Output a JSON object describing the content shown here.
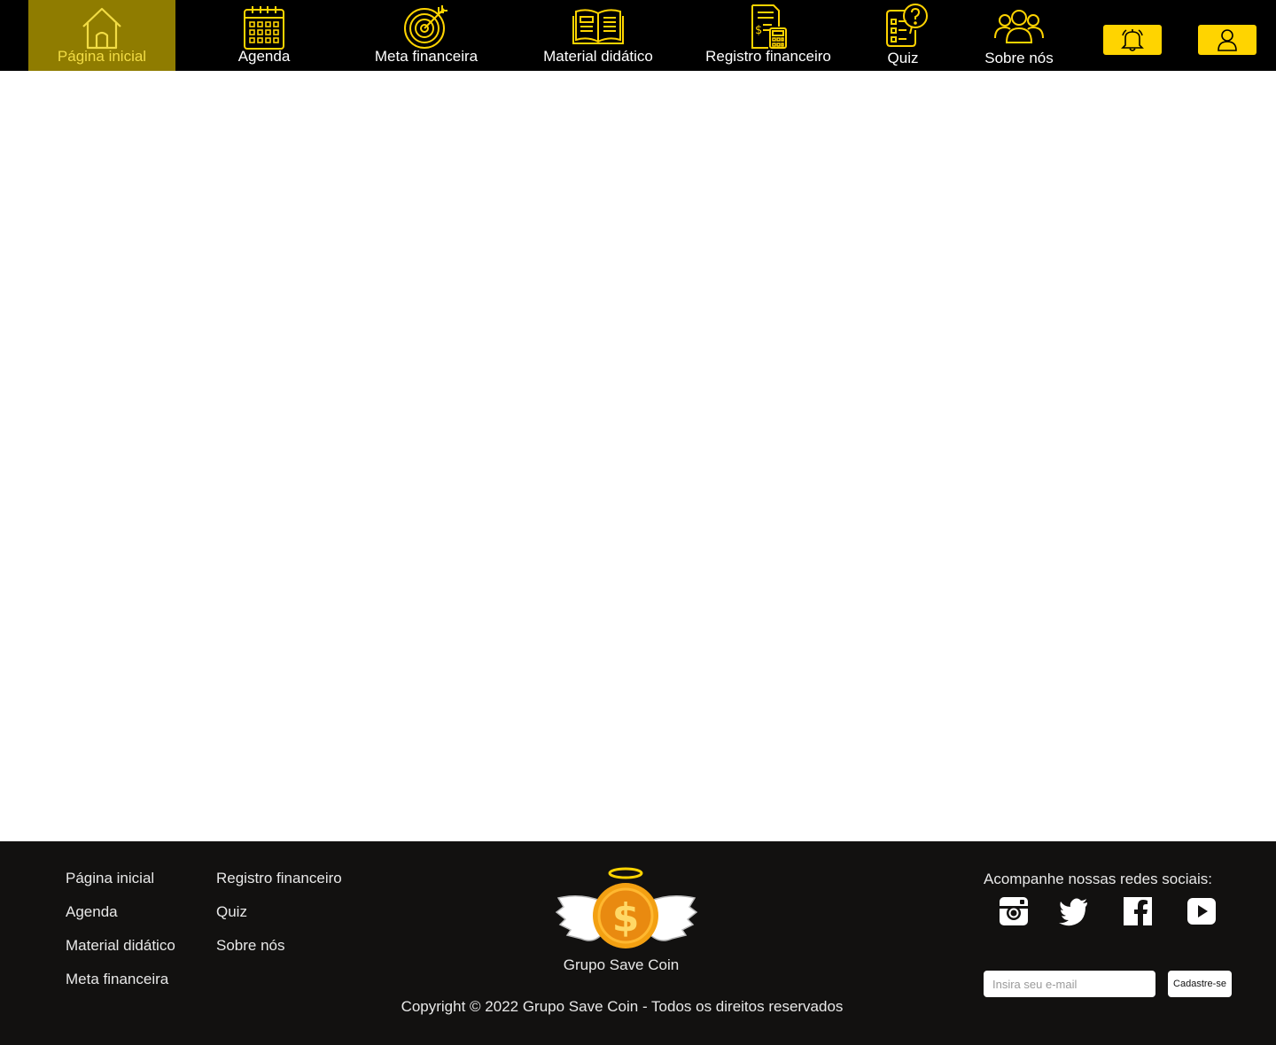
{
  "nav": {
    "items": [
      {
        "label": "Página inicial",
        "icon": "home-icon",
        "active": true
      },
      {
        "label": "Agenda",
        "icon": "calendar-icon"
      },
      {
        "label": "Meta financeira",
        "icon": "target-icon"
      },
      {
        "label": "Material didático",
        "icon": "book-icon"
      },
      {
        "label": "Registro financeiro",
        "icon": "financial-record-icon"
      },
      {
        "label": "Quiz",
        "icon": "quiz-icon"
      },
      {
        "label": "Sobre nós",
        "icon": "group-icon"
      }
    ],
    "notification_icon": "bell-icon",
    "profile_icon": "user-icon"
  },
  "footer": {
    "links_col1": [
      "Página inicial",
      "Agenda",
      "Material didático",
      "Meta financeira"
    ],
    "links_col2": [
      "Registro financeiro",
      "Quiz",
      "Sobre nós"
    ],
    "brand_name": "Grupo Save Coin",
    "copyright": "Copyright © 2022 Grupo Save Coin - Todos os direitos reservados",
    "social_title": "Acompanhe nossas redes sociais:",
    "social_icons": [
      "instagram-icon",
      "twitter-icon",
      "facebook-icon",
      "youtube-icon"
    ],
    "email_placeholder": "Insira seu e-mail",
    "signup_label": "Cadastre-se"
  },
  "colors": {
    "topbar": "#000000",
    "accent_yellow": "#ffd400",
    "active_nav_bg": "#8f7c00",
    "footer_bg": "#121110"
  }
}
